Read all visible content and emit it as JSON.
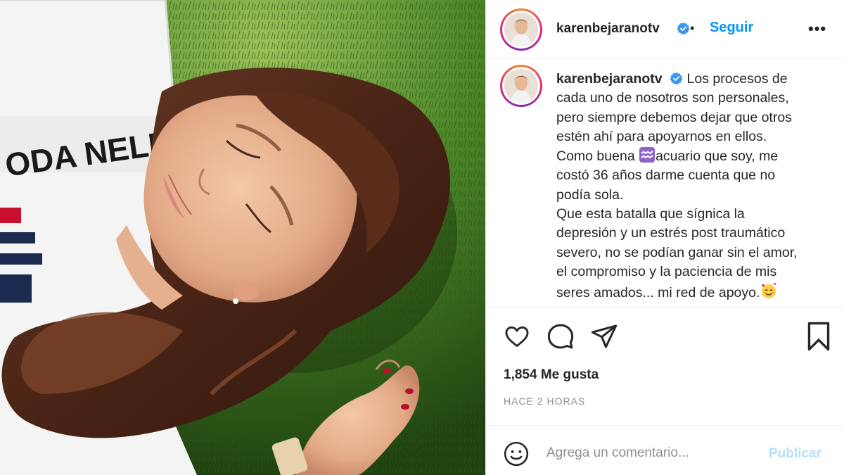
{
  "post": {
    "username": "karenbejaranotv",
    "verified": true,
    "follow_label": "Seguir",
    "separator": "•",
    "more_label": "•••",
    "photo": {
      "shirt_text": "ODA NELLA"
    }
  },
  "caption": {
    "username": "karenbejaranotv",
    "line1": "Los procesos de",
    "line2": "cada uno de nosotros son personales,",
    "line3": "pero siempre debemos dejar que otros",
    "line4": "estén ahí para apoyarnos en ellos.",
    "line5_before": "Como buena ",
    "line5_after": "acuario que soy, me",
    "line6": "costó 36 años darme cuenta que no",
    "line7": "podía sola.",
    "line8": "Que esta batalla que sígnica la",
    "line9": "depresión y un estrés post traumático",
    "line10": "severo, no se podían ganar sin el amor,",
    "line11": "el compromiso y la paciencia de mis",
    "line12": "seres amados... mi red de apoyo.",
    "aquarius_emoji": "♒",
    "smile_emoji": "🥰"
  },
  "actions": {
    "likes": "1,854 Me gusta",
    "timestamp": "HACE 2 HORAS"
  },
  "comment": {
    "placeholder": "Agrega un comentario...",
    "publish_label": "Publicar"
  },
  "colors": {
    "accent": "#0095f6",
    "publish_disabled": "#b2dffc",
    "muted": "#8e8e8e",
    "text": "#262626",
    "grass": "#2f5a1b"
  }
}
